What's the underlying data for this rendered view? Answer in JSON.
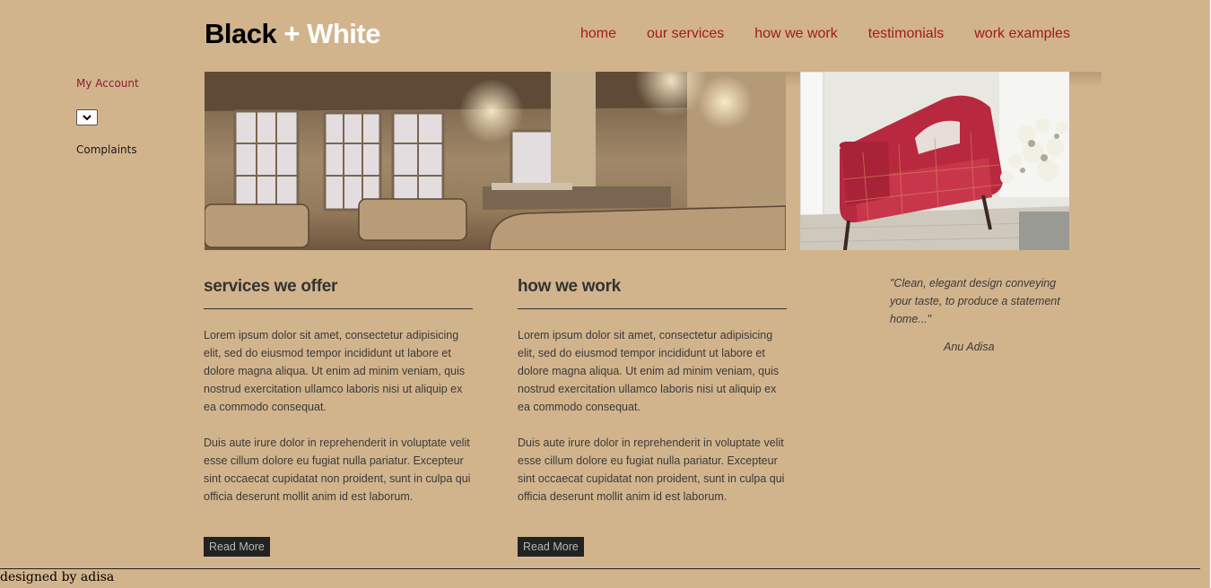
{
  "logo": {
    "part1": "Black",
    "part2": "+ White"
  },
  "nav": {
    "items": [
      {
        "label": "home"
      },
      {
        "label": "our services"
      },
      {
        "label": "how we work"
      },
      {
        "label": "testimonials"
      },
      {
        "label": "work examples"
      }
    ]
  },
  "sidebar": {
    "account_label": "My Account",
    "select_value": "",
    "complaints_label": "Complaints"
  },
  "columns": [
    {
      "title": "services we offer",
      "para1": "Lorem ipsum dolor sit amet, consectetur adipisicing elit, sed do eiusmod tempor incididunt ut labore et dolore magna aliqua. Ut enim ad minim veniam, quis nostrud exercitation ullamco laboris nisi ut aliquip ex ea commodo consequat.",
      "para2": "Duis aute irure dolor in reprehenderit in voluptate velit esse cillum dolore eu fugiat nulla pariatur. Excepteur sint occaecat cupidatat non proident, sunt in culpa qui officia deserunt mollit anim id est laborum.",
      "button": "Read More"
    },
    {
      "title": "how we work",
      "para1": "Lorem ipsum dolor sit amet, consectetur adipisicing elit, sed do eiusmod tempor incididunt ut labore et dolore magna aliqua. Ut enim ad minim veniam, quis nostrud exercitation ullamco laboris nisi ut aliquip ex ea commodo consequat.",
      "para2": "Duis aute irure dolor in reprehenderit in voluptate velit esse cillum dolore eu fugiat nulla pariatur. Excepteur sint occaecat cupidatat non proident, sunt in culpa qui officia deserunt mollit anim id est laborum.",
      "button": "Read More"
    }
  ],
  "testimonial": {
    "quote": "\"Clean, elegant design conveying your taste, to produce a statement home...\"",
    "author": "Anu Adisa"
  },
  "footer": {
    "text": "designed by adisa"
  },
  "colors": {
    "background": "#d2b48c",
    "nav_link": "#a11b1b",
    "account_link": "#8b1a3a",
    "button_bg": "#222222"
  }
}
